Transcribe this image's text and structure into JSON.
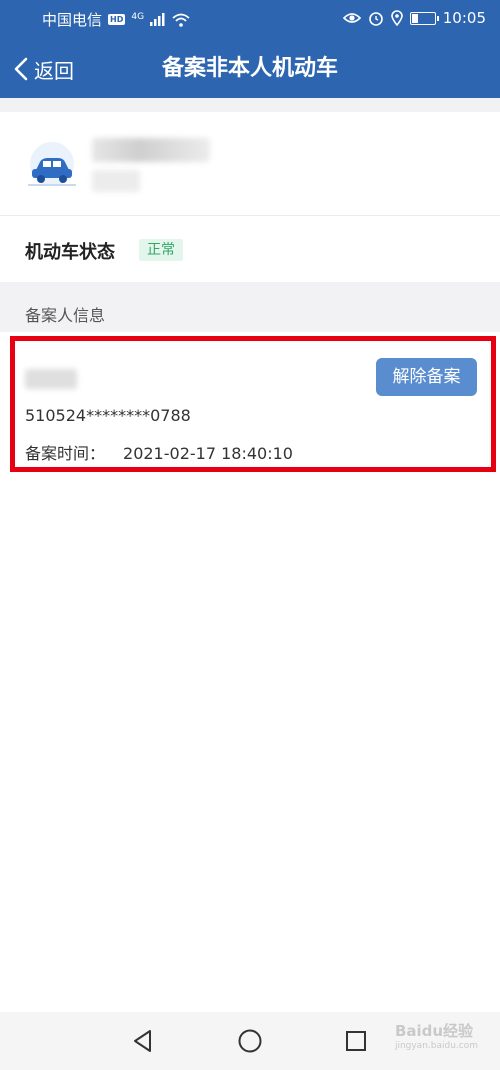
{
  "statusbar": {
    "carrier": "中国电信",
    "hd": "HD",
    "network": "4G",
    "time": "10:05"
  },
  "header": {
    "back_label": "返回",
    "title": "备案非本人机动车"
  },
  "vehicle_status": {
    "label": "机动车状态",
    "badge": "正常",
    "badge_color": "#35a46b"
  },
  "section": {
    "title": "备案人信息"
  },
  "record": {
    "id_number": "510524********0788",
    "time_label": "备案时间：",
    "time_value": "2021-02-17 18:40:10",
    "unbind_label": "解除备案"
  },
  "colors": {
    "header": "#2e65b0",
    "button": "#5a8dd0",
    "highlight": "#e60012"
  },
  "watermark": {
    "brand": "Baidu经验",
    "url": "jingyan.baidu.com"
  }
}
